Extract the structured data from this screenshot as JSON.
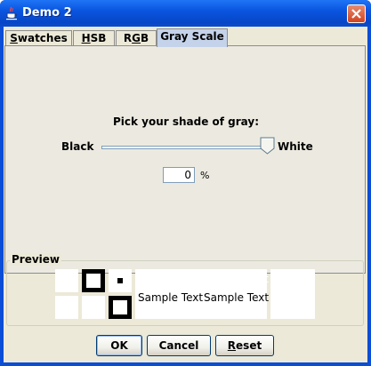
{
  "window": {
    "title": "Demo 2"
  },
  "tabs": [
    {
      "label": "Swatches",
      "mnemonic": "S",
      "rest": "watches"
    },
    {
      "label": "HSB",
      "mnemonic": "H",
      "rest": "SB"
    },
    {
      "label": "RGB",
      "pre": "R",
      "mnemonic": "G",
      "rest": "B"
    },
    {
      "label": "Gray Scale",
      "selected": true
    }
  ],
  "gray_panel": {
    "prompt": "Pick your shade of gray:",
    "min_label": "Black",
    "max_label": "White",
    "slider_value_percent": 100,
    "value": "0",
    "unit": "%"
  },
  "preview": {
    "title": "Preview",
    "sample_text": "Sample Text",
    "samples": [
      {
        "text": "Sample Text",
        "color": "#ffffff"
      },
      {
        "text": "Sample Text",
        "color": "#ffffff"
      },
      {
        "text": "Sample Text",
        "color": "#000000"
      },
      {
        "text": "Sample Text",
        "color": "#000000"
      }
    ]
  },
  "buttons": {
    "ok": "OK",
    "cancel": "Cancel",
    "reset_mnemonic": "R",
    "reset_rest": "eset"
  },
  "colors": {
    "titlebar": "#0a55e0",
    "selected_tab": "#c5d3ea",
    "panel": "#ece9d8",
    "close": "#d2431f"
  }
}
